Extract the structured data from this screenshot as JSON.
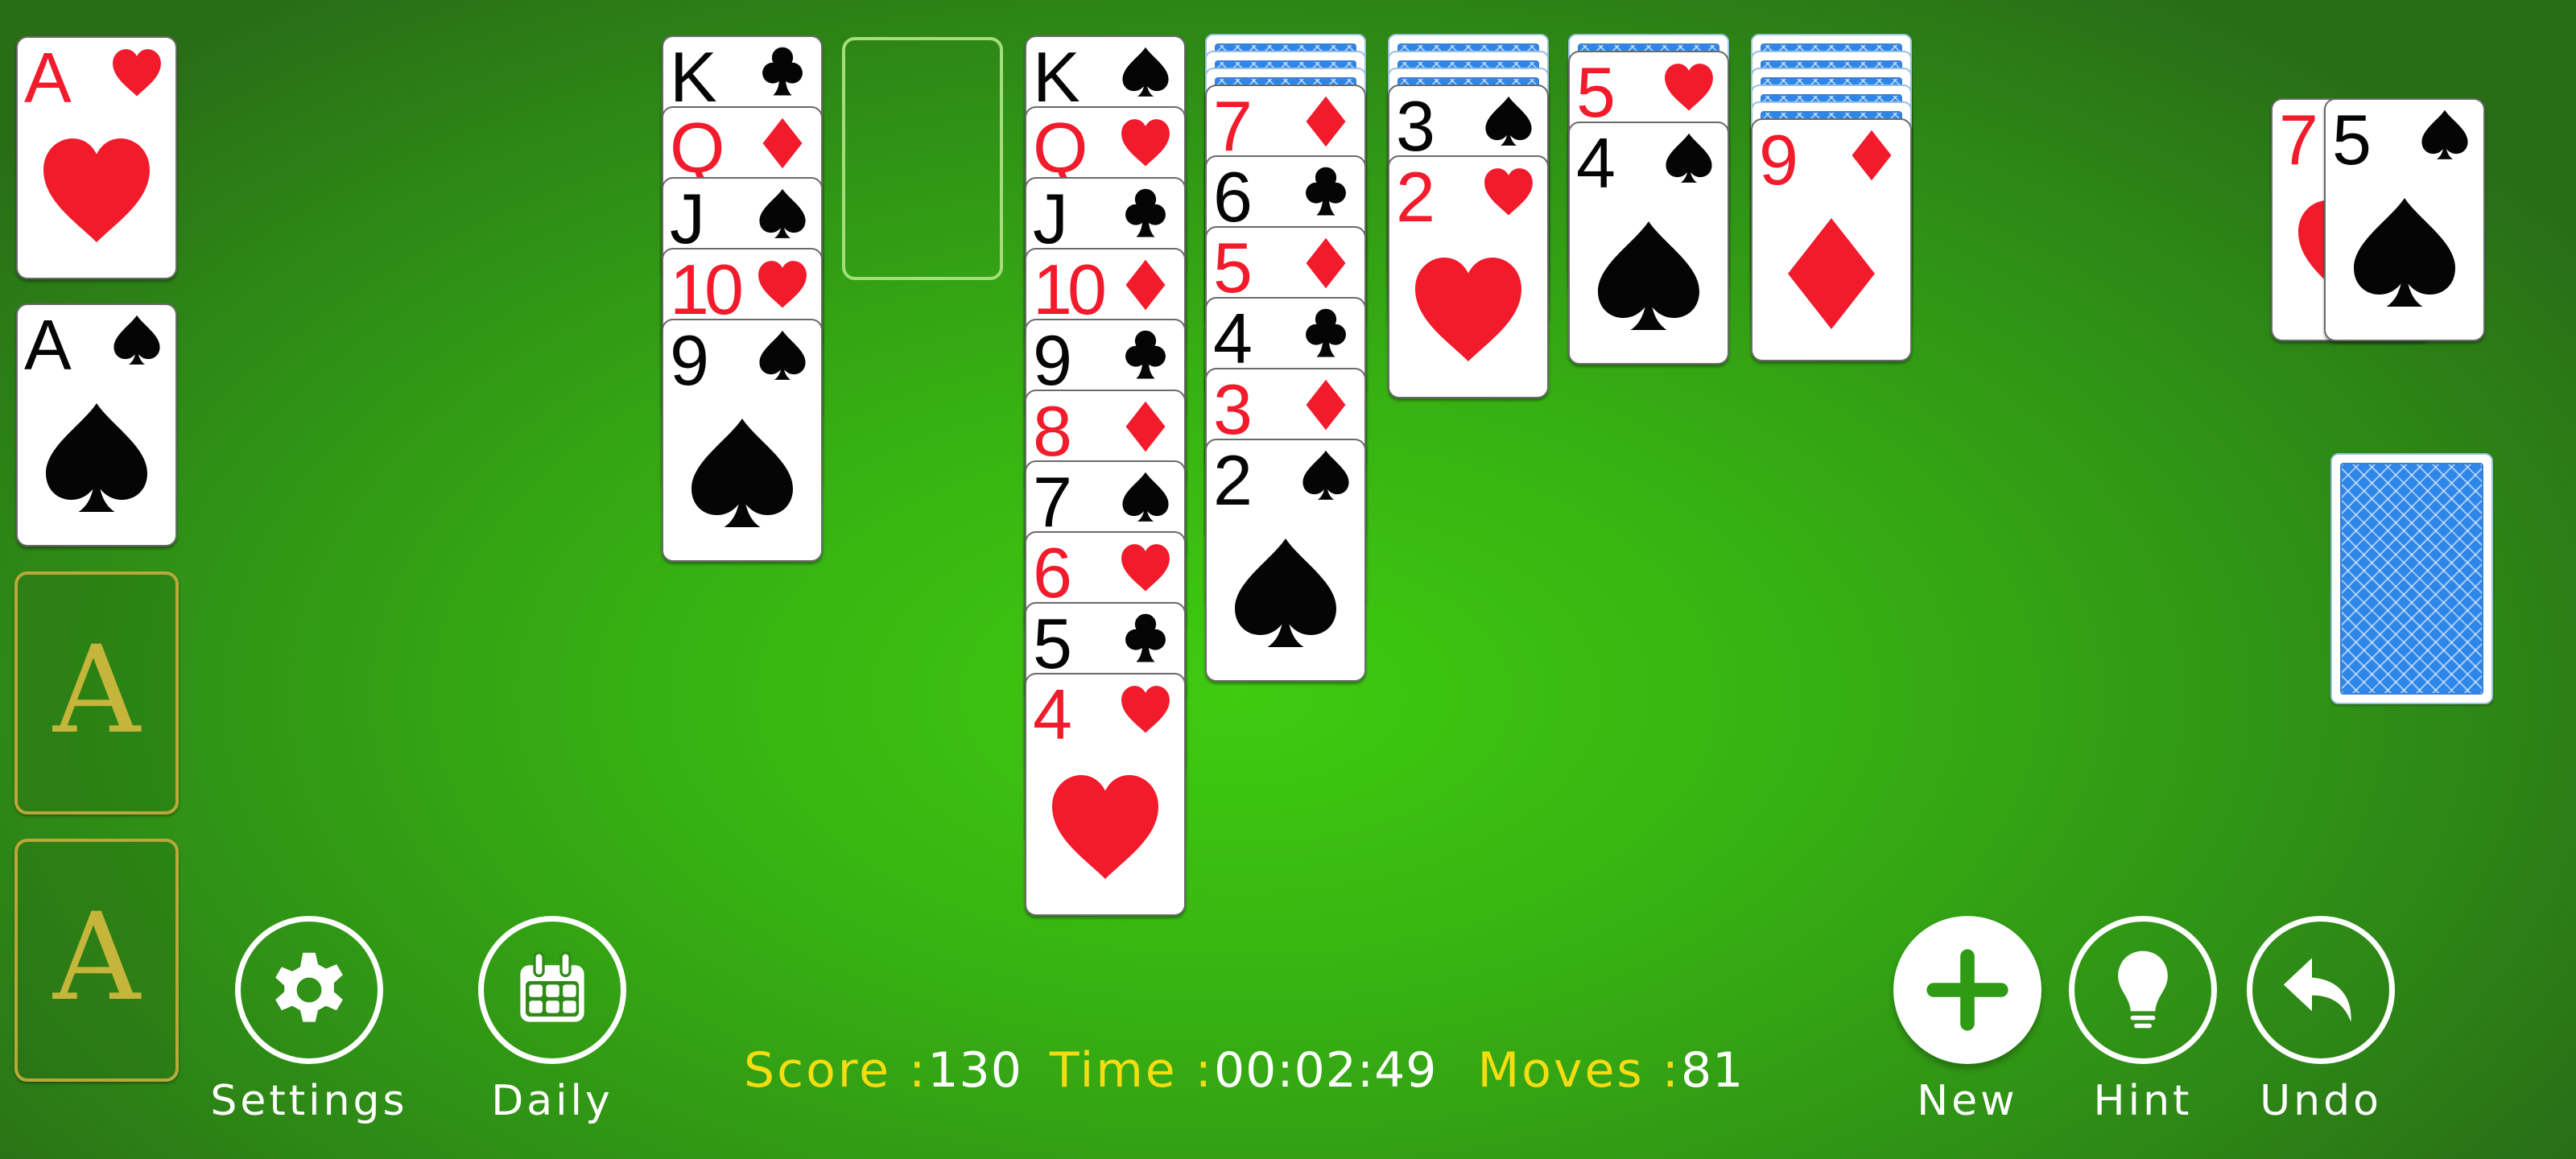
{
  "game": "Solitaire",
  "colors": {
    "table_center": "#3fcb10",
    "table_edge": "#296d17",
    "red_suit": "#f21b2c",
    "black_suit": "#050505",
    "status_label": "#f6dd12",
    "status_value": "#ffffff",
    "foundation_placeholder": "#c5b53a",
    "card_back": "#2d86e8"
  },
  "foundations": [
    {
      "state": "card",
      "rank": "A",
      "suit": "hearts"
    },
    {
      "state": "card",
      "rank": "A",
      "suit": "spades"
    },
    {
      "state": "empty",
      "placeholder": "A"
    },
    {
      "state": "empty",
      "placeholder": "A"
    }
  ],
  "tableau": [
    {
      "face_down": 0,
      "face_up": [
        {
          "rank": "K",
          "suit": "clubs"
        },
        {
          "rank": "Q",
          "suit": "diamonds"
        },
        {
          "rank": "J",
          "suit": "spades"
        },
        {
          "rank": "10",
          "suit": "hearts"
        },
        {
          "rank": "9",
          "suit": "spades"
        }
      ]
    },
    {
      "face_down": 0,
      "face_up": []
    },
    {
      "face_down": 0,
      "face_up": [
        {
          "rank": "K",
          "suit": "spades"
        },
        {
          "rank": "Q",
          "suit": "hearts"
        },
        {
          "rank": "J",
          "suit": "clubs"
        },
        {
          "rank": "10",
          "suit": "diamonds"
        },
        {
          "rank": "9",
          "suit": "clubs"
        },
        {
          "rank": "8",
          "suit": "diamonds"
        },
        {
          "rank": "7",
          "suit": "spades"
        },
        {
          "rank": "6",
          "suit": "hearts"
        },
        {
          "rank": "5",
          "suit": "clubs"
        },
        {
          "rank": "4",
          "suit": "hearts"
        }
      ]
    },
    {
      "face_down": 3,
      "face_up": [
        {
          "rank": "7",
          "suit": "diamonds"
        },
        {
          "rank": "6",
          "suit": "clubs"
        },
        {
          "rank": "5",
          "suit": "diamonds"
        },
        {
          "rank": "4",
          "suit": "clubs"
        },
        {
          "rank": "3",
          "suit": "diamonds"
        },
        {
          "rank": "2",
          "suit": "spades"
        }
      ]
    },
    {
      "face_down": 3,
      "face_up": [
        {
          "rank": "3",
          "suit": "spades"
        },
        {
          "rank": "2",
          "suit": "hearts"
        }
      ]
    },
    {
      "face_down": 1,
      "face_up": [
        {
          "rank": "5",
          "suit": "hearts"
        },
        {
          "rank": "4",
          "suit": "spades"
        }
      ]
    },
    {
      "face_down": 5,
      "face_up": [
        {
          "rank": "9",
          "suit": "diamonds"
        }
      ]
    }
  ],
  "waste": [
    {
      "rank": "7",
      "suit": "hearts"
    },
    {
      "rank": "5",
      "suit": "spades"
    }
  ],
  "stock": {
    "has_cards": true
  },
  "status": {
    "score_label": "Score :",
    "score": "130",
    "time_label": "Time :",
    "time": "00:02:49",
    "moves_label": "Moves :",
    "moves": "81"
  },
  "buttons": {
    "settings": {
      "label": "Settings",
      "icon": "gear-icon"
    },
    "daily": {
      "label": "Daily",
      "icon": "calendar-icon"
    },
    "new": {
      "label": "New",
      "icon": "plus-icon"
    },
    "hint": {
      "label": "Hint",
      "icon": "lightbulb-icon"
    },
    "undo": {
      "label": "Undo",
      "icon": "undo-arrow-icon"
    }
  }
}
